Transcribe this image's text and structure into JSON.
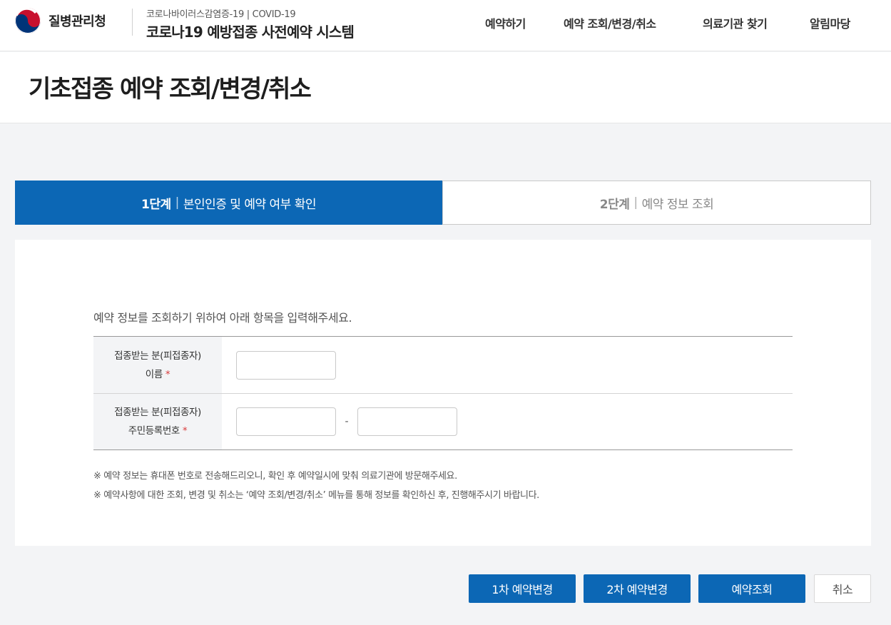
{
  "header": {
    "org_name": "질병관리청",
    "system_subtitle": "코로나바이러스감염증-19 | COVID-19",
    "system_title": "코로나19 예방접종 사전예약 시스템",
    "nav": [
      {
        "label": "예약하기"
      },
      {
        "label": "예약 조회/변경/취소"
      },
      {
        "label": "의료기관 찾기"
      },
      {
        "label": "알림마당"
      }
    ]
  },
  "page": {
    "title": "기초접종 예약 조회/변경/취소"
  },
  "steps": [
    {
      "num": "1단계",
      "label": "본인인증 및 예약 여부 확인",
      "active": true
    },
    {
      "num": "2단계",
      "label": "예약 정보 조회",
      "active": false
    }
  ],
  "form": {
    "intro": "예약 정보를 조회하기 위하여 아래 항목을 입력해주세요.",
    "fields": [
      {
        "label_line1": "접종받는 분(피접종자)",
        "label_line2": "이름",
        "required": "*",
        "value": ""
      },
      {
        "label_line1": "접종받는 분(피접종자)",
        "label_line2": "주민등록번호",
        "required": "*",
        "value_front": "",
        "value_back": ""
      }
    ],
    "separator": "-",
    "notes": [
      "※ 예약 정보는 휴대폰 번호로 전송해드리오니, 확인 후 예약일시에 맞춰 의료기관에 방문해주세요.",
      "※ 예약사항에 대한 조회, 변경 및 취소는 ‘예약 조회/변경/취소’ 메뉴를 통해 정보를 확인하신 후, 진행해주시기 바랍니다."
    ]
  },
  "buttons": {
    "change1": "1차 예약변경",
    "change2": "2차 예약변경",
    "lookup": "예약조회",
    "cancel": "취소"
  },
  "colors": {
    "primary": "#0c67b5",
    "required": "#d93b3b"
  }
}
